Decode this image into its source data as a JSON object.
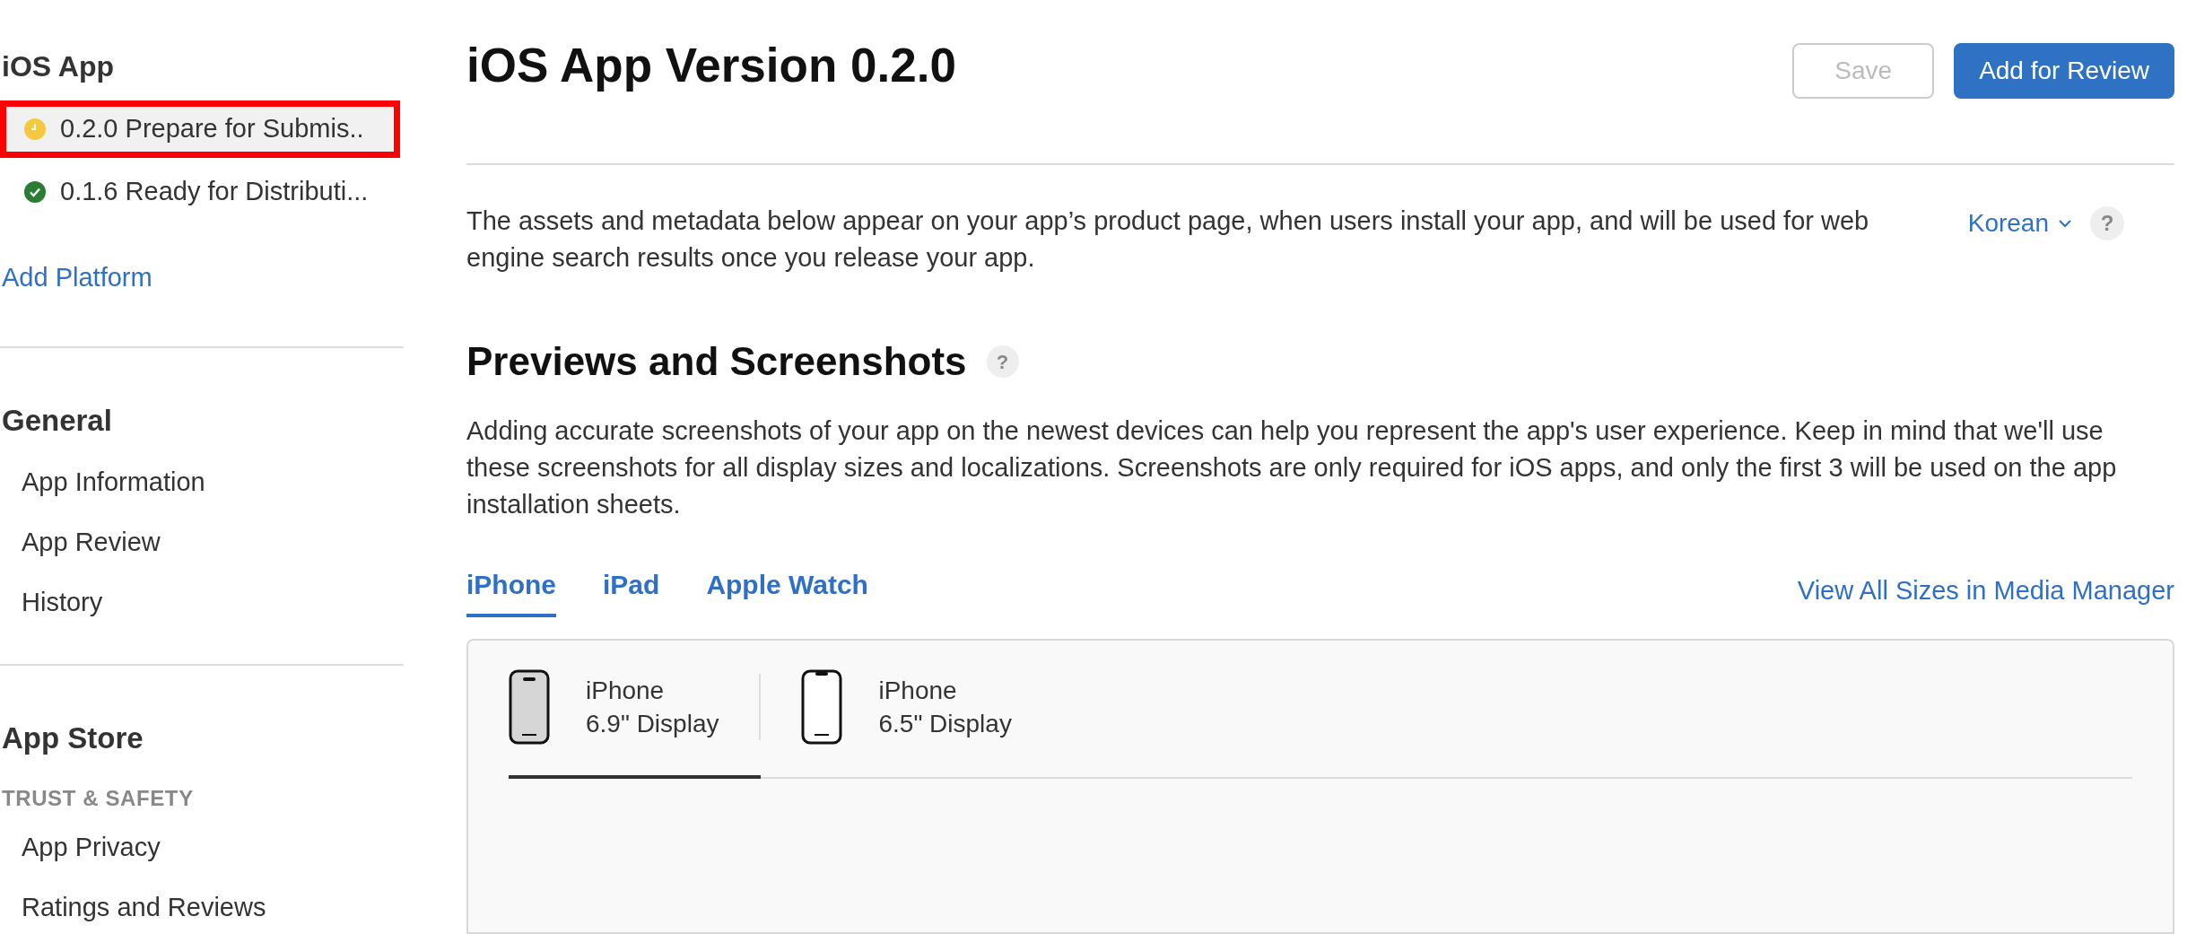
{
  "sidebar": {
    "platform": {
      "title": "iOS App",
      "versions": [
        {
          "label": "0.2.0 Prepare for Submis..",
          "kind": "pending",
          "selected": true
        },
        {
          "label": "0.1.6 Ready for Distributi...",
          "kind": "ready",
          "selected": false
        }
      ],
      "add_link": "Add Platform"
    },
    "sections": [
      {
        "title": "General",
        "groups": [
          {
            "items": [
              "App Information",
              "App Review",
              "History"
            ]
          }
        ]
      },
      {
        "title": "App Store",
        "groups": [
          {
            "heading": "TRUST & SAFETY",
            "items": [
              "App Privacy",
              "Ratings and Reviews"
            ]
          }
        ]
      }
    ]
  },
  "header": {
    "title": "iOS App Version 0.2.0",
    "buttons": [
      {
        "label": "Save",
        "kind": "secondary",
        "disabled": true
      },
      {
        "label": "Add for Review",
        "kind": "primary",
        "disabled": false
      }
    ]
  },
  "intro": {
    "text": "The assets and metadata below appear on your app’s product page, when users install your app, and will be used for web engine search results once you release your app.",
    "language": "Korean",
    "help": "?"
  },
  "screenshots": {
    "title": "Previews and Screenshots",
    "help": "?",
    "description": "Adding accurate screenshots of your app on the newest devices can help you represent the app's user experience. Keep in mind that we'll use these screenshots for all display sizes and localizations. Screenshots are only required for iOS apps, and only the first 3 will be used on the app installation sheets.",
    "tabs": [
      {
        "label": "iPhone",
        "selected": true
      },
      {
        "label": "iPad",
        "selected": false
      },
      {
        "label": "Apple Watch",
        "selected": false
      }
    ],
    "media_link": "View All Sizes in Media Manager",
    "devices": [
      {
        "name": "iPhone",
        "size": "6.9\" Display",
        "selected": true
      },
      {
        "name": "iPhone",
        "size": "6.5\" Display",
        "selected": false
      }
    ]
  }
}
